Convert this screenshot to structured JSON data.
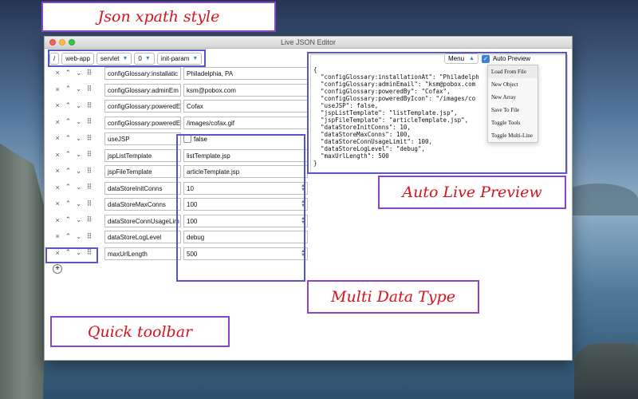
{
  "window": {
    "title": "Live JSON Editor"
  },
  "pathbar": {
    "root": "/",
    "segments": [
      {
        "label": "web-app",
        "has_menu": false
      },
      {
        "label": "servlet",
        "has_menu": true
      },
      {
        "label": "0",
        "has_menu": true
      },
      {
        "label": "init-param",
        "has_menu": true
      }
    ]
  },
  "rows": [
    {
      "key": "configGlossary:installatic",
      "value": "Philadelphia, PA",
      "type": "string"
    },
    {
      "key": "configGlossary:adminEm",
      "value": "ksm@pobox.com",
      "type": "string"
    },
    {
      "key": "configGlossary:poweredE",
      "value": "Cofax",
      "type": "string"
    },
    {
      "key": "configGlossary:poweredE",
      "value": "/images/cofax.gif",
      "type": "string"
    },
    {
      "key": "useJSP",
      "value": "false",
      "type": "boolean"
    },
    {
      "key": "jspListTemplate",
      "value": "listTemplate.jsp",
      "type": "string"
    },
    {
      "key": "jspFileTemplate",
      "value": "articleTemplate.jsp",
      "type": "string"
    },
    {
      "key": "dataStoreInitConns",
      "value": "10",
      "type": "number"
    },
    {
      "key": "dataStoreMaxConns",
      "value": "100",
      "type": "number"
    },
    {
      "key": "dataStoreConnUsageLim",
      "value": "100",
      "type": "number"
    },
    {
      "key": "dataStoreLogLevel",
      "value": "debug",
      "type": "string"
    },
    {
      "key": "maxUrlLength",
      "value": "500",
      "type": "number"
    }
  ],
  "preview": {
    "text": "{\n  \"configGlossary:installationAt\": \"Philadelph\n  \"configGlossary:adminEmail\": \"ksm@pobox.com\n  \"configGlossary:poweredBy\": \"Cofax\",\n  \"configGlossary:poweredByIcon\": \"/images/co\n  \"useJSP\": false,\n  \"jspListTemplate\": \"listTemplate.jsp\",\n  \"jspFileTemplate\": \"articleTemplate.jsp\",\n  \"dataStoreInitConns\": 10,\n  \"dataStoreMaxConns\": 100,\n  \"dataStoreConnUsageLimit\": 100,\n  \"dataStoreLogLevel\": \"debug\",\n  \"maxUrlLength\": 500\n}"
  },
  "menu": {
    "label": "Menu",
    "auto_preview_label": "Auto Preview",
    "auto_preview_checked": true,
    "items": [
      "Load From File",
      "New Object",
      "New Array",
      "Save To File",
      "Toggle Tools",
      "Toggle Multi-Line"
    ]
  },
  "callouts": {
    "json_xpath": "Json xpath style",
    "auto_preview": "Auto Live Preview",
    "multi_type": "Multi Data Type",
    "quick_toolbar": "Quick toolbar"
  },
  "colors": {
    "callout_text": "#d3131d",
    "callout_border": "#8a45c9",
    "accent": "#3b82d6"
  }
}
